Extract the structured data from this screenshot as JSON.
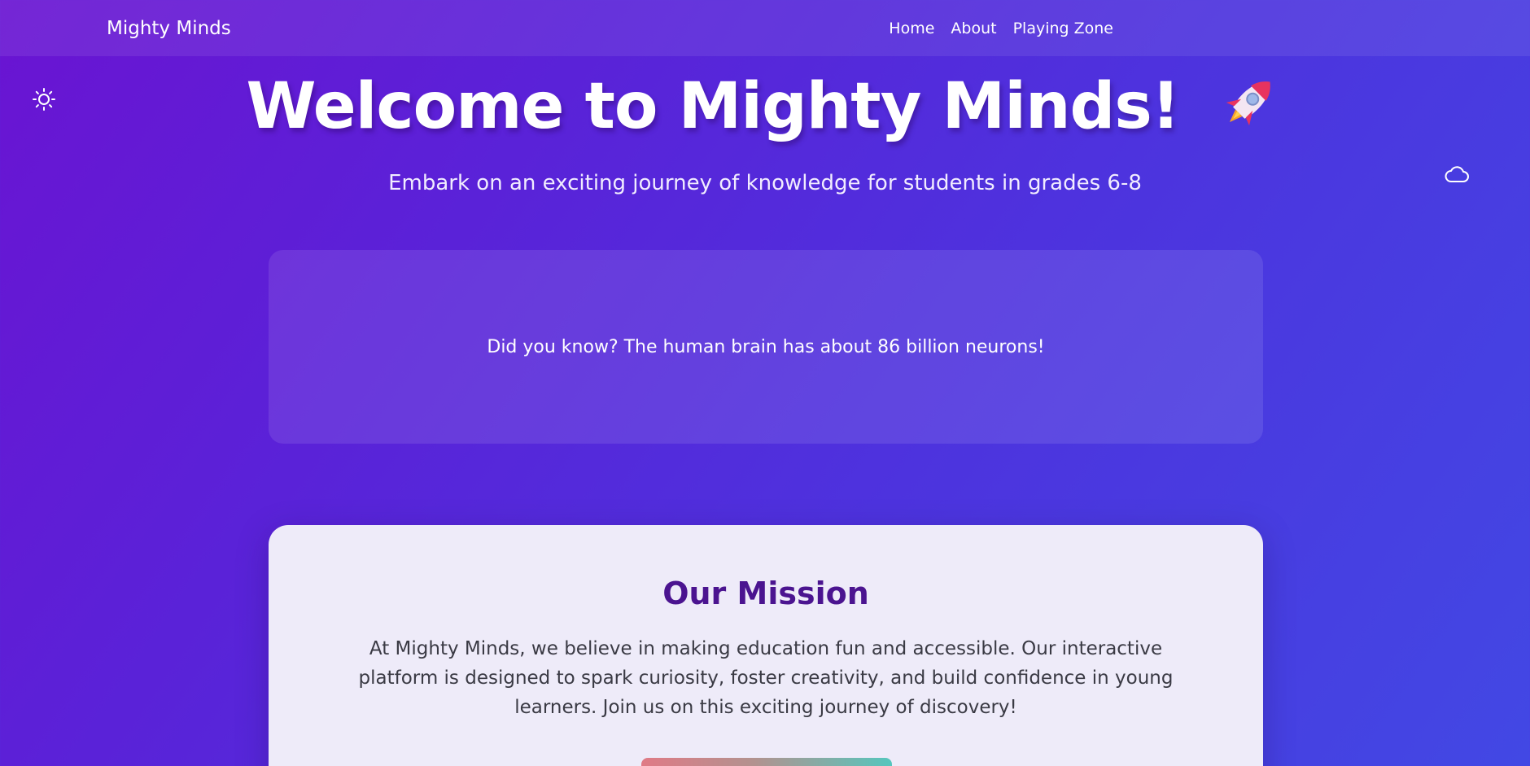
{
  "nav": {
    "brand": "Mighty Minds",
    "links": [
      "Home",
      "About",
      "Playing Zone"
    ]
  },
  "hero": {
    "title": "Welcome to Mighty Minds!",
    "subtitle": "Embark on an exciting journey of knowledge for students in grades 6-8"
  },
  "fact": {
    "text": "Did you know? The human brain has about 86 billion neurons!"
  },
  "mission": {
    "title": "Our Mission",
    "text": "At Mighty Minds, we believe in making education fun and accessible. Our interactive platform is designed to spark curiosity, foster creativity, and build confidence in young learners. Join us on this exciting journey of discovery!"
  },
  "icons": {
    "theme_toggle": "sun-icon",
    "decor": "cloud-icon",
    "title_emoji": "rocket-icon"
  },
  "colors": {
    "bg_start": "#6a14d2",
    "bg_end": "#4248e4",
    "mission_title": "#4b1490",
    "mission_card": "#eeebf9",
    "button_gradient_start": "#e07a86",
    "button_gradient_end": "#55c6bd"
  }
}
